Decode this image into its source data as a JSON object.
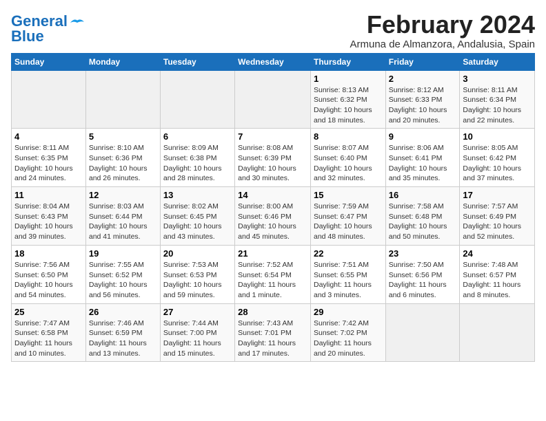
{
  "header": {
    "logo_line1": "General",
    "logo_line2": "Blue",
    "month": "February 2024",
    "location": "Armuna de Almanzora, Andalusia, Spain"
  },
  "days_of_week": [
    "Sunday",
    "Monday",
    "Tuesday",
    "Wednesday",
    "Thursday",
    "Friday",
    "Saturday"
  ],
  "weeks": [
    [
      {
        "day": "",
        "info": ""
      },
      {
        "day": "",
        "info": ""
      },
      {
        "day": "",
        "info": ""
      },
      {
        "day": "",
        "info": ""
      },
      {
        "day": "1",
        "info": "Sunrise: 8:13 AM\nSunset: 6:32 PM\nDaylight: 10 hours\nand 18 minutes."
      },
      {
        "day": "2",
        "info": "Sunrise: 8:12 AM\nSunset: 6:33 PM\nDaylight: 10 hours\nand 20 minutes."
      },
      {
        "day": "3",
        "info": "Sunrise: 8:11 AM\nSunset: 6:34 PM\nDaylight: 10 hours\nand 22 minutes."
      }
    ],
    [
      {
        "day": "4",
        "info": "Sunrise: 8:11 AM\nSunset: 6:35 PM\nDaylight: 10 hours\nand 24 minutes."
      },
      {
        "day": "5",
        "info": "Sunrise: 8:10 AM\nSunset: 6:36 PM\nDaylight: 10 hours\nand 26 minutes."
      },
      {
        "day": "6",
        "info": "Sunrise: 8:09 AM\nSunset: 6:38 PM\nDaylight: 10 hours\nand 28 minutes."
      },
      {
        "day": "7",
        "info": "Sunrise: 8:08 AM\nSunset: 6:39 PM\nDaylight: 10 hours\nand 30 minutes."
      },
      {
        "day": "8",
        "info": "Sunrise: 8:07 AM\nSunset: 6:40 PM\nDaylight: 10 hours\nand 32 minutes."
      },
      {
        "day": "9",
        "info": "Sunrise: 8:06 AM\nSunset: 6:41 PM\nDaylight: 10 hours\nand 35 minutes."
      },
      {
        "day": "10",
        "info": "Sunrise: 8:05 AM\nSunset: 6:42 PM\nDaylight: 10 hours\nand 37 minutes."
      }
    ],
    [
      {
        "day": "11",
        "info": "Sunrise: 8:04 AM\nSunset: 6:43 PM\nDaylight: 10 hours\nand 39 minutes."
      },
      {
        "day": "12",
        "info": "Sunrise: 8:03 AM\nSunset: 6:44 PM\nDaylight: 10 hours\nand 41 minutes."
      },
      {
        "day": "13",
        "info": "Sunrise: 8:02 AM\nSunset: 6:45 PM\nDaylight: 10 hours\nand 43 minutes."
      },
      {
        "day": "14",
        "info": "Sunrise: 8:00 AM\nSunset: 6:46 PM\nDaylight: 10 hours\nand 45 minutes."
      },
      {
        "day": "15",
        "info": "Sunrise: 7:59 AM\nSunset: 6:47 PM\nDaylight: 10 hours\nand 48 minutes."
      },
      {
        "day": "16",
        "info": "Sunrise: 7:58 AM\nSunset: 6:48 PM\nDaylight: 10 hours\nand 50 minutes."
      },
      {
        "day": "17",
        "info": "Sunrise: 7:57 AM\nSunset: 6:49 PM\nDaylight: 10 hours\nand 52 minutes."
      }
    ],
    [
      {
        "day": "18",
        "info": "Sunrise: 7:56 AM\nSunset: 6:50 PM\nDaylight: 10 hours\nand 54 minutes."
      },
      {
        "day": "19",
        "info": "Sunrise: 7:55 AM\nSunset: 6:52 PM\nDaylight: 10 hours\nand 56 minutes."
      },
      {
        "day": "20",
        "info": "Sunrise: 7:53 AM\nSunset: 6:53 PM\nDaylight: 10 hours\nand 59 minutes."
      },
      {
        "day": "21",
        "info": "Sunrise: 7:52 AM\nSunset: 6:54 PM\nDaylight: 11 hours\nand 1 minute."
      },
      {
        "day": "22",
        "info": "Sunrise: 7:51 AM\nSunset: 6:55 PM\nDaylight: 11 hours\nand 3 minutes."
      },
      {
        "day": "23",
        "info": "Sunrise: 7:50 AM\nSunset: 6:56 PM\nDaylight: 11 hours\nand 6 minutes."
      },
      {
        "day": "24",
        "info": "Sunrise: 7:48 AM\nSunset: 6:57 PM\nDaylight: 11 hours\nand 8 minutes."
      }
    ],
    [
      {
        "day": "25",
        "info": "Sunrise: 7:47 AM\nSunset: 6:58 PM\nDaylight: 11 hours\nand 10 minutes."
      },
      {
        "day": "26",
        "info": "Sunrise: 7:46 AM\nSunset: 6:59 PM\nDaylight: 11 hours\nand 13 minutes."
      },
      {
        "day": "27",
        "info": "Sunrise: 7:44 AM\nSunset: 7:00 PM\nDaylight: 11 hours\nand 15 minutes."
      },
      {
        "day": "28",
        "info": "Sunrise: 7:43 AM\nSunset: 7:01 PM\nDaylight: 11 hours\nand 17 minutes."
      },
      {
        "day": "29",
        "info": "Sunrise: 7:42 AM\nSunset: 7:02 PM\nDaylight: 11 hours\nand 20 minutes."
      },
      {
        "day": "",
        "info": ""
      },
      {
        "day": "",
        "info": ""
      }
    ]
  ]
}
